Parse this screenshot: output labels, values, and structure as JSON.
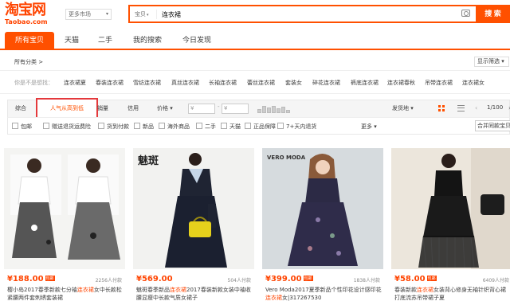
{
  "header": {
    "logo_main": "淘宝网",
    "logo_sub": "Taobao.com",
    "market_label": "更多市场",
    "scope_label": "宝贝",
    "query": "连衣裙",
    "search_label": "搜 索"
  },
  "nav": {
    "tabs": [
      {
        "label": "所有宝贝",
        "active": true
      },
      {
        "label": "天猫"
      },
      {
        "label": "二手"
      },
      {
        "label": "我的搜索"
      },
      {
        "label": "今日发现"
      }
    ]
  },
  "filters": {
    "all_categories": "所有分类 >",
    "display_filter": "显示筛选",
    "suggest_label": "你是不是想找：",
    "suggestions": [
      "连衣裙夏",
      "春装连衣裙",
      "雪纺连衣裙",
      "真丝连衣裙",
      "长袖连衣裙",
      "蕾丝连衣裙",
      "套装女",
      "碎花连衣裙",
      "裤底连衣裙",
      "连衣裙春秋",
      "吊带连衣裙",
      "连衣裙女"
    ]
  },
  "sort": {
    "comprehensive": "综合",
    "popular": "人气从高到低",
    "sales": "销量",
    "credit": "信用",
    "price": "价格",
    "price_from": "¥",
    "price_to": "¥",
    "ship_from": "发货地",
    "page_label": "1/100"
  },
  "checks": {
    "items": [
      "包邮",
      "赠送退货运费险",
      "货到付款",
      "新品",
      "海外商品",
      "二手",
      "天猫",
      "正品保障",
      "7+天内退货"
    ],
    "more_label": "更多",
    "merge_label": "合并同款宝贝"
  },
  "products": [
    {
      "price": "¥188.00",
      "badge": "包邮",
      "sold": "2256人付款",
      "title_pre": "樱小岛2017春季新款七分袖",
      "title_hl": "连衣裙",
      "title_post": "女中长款松紧腰两件套刺绣套装裙"
    },
    {
      "price": "¥569.00",
      "badge": "",
      "sold": "504人付款",
      "title_pre": "魅斑春季新品",
      "title_hl": "连衣裙",
      "title_post": "2017春装新款女装中袖收腰显瘦中长款气质女裙子"
    },
    {
      "price": "¥399.00",
      "badge": "包邮",
      "sold": "1838人付款",
      "title_pre": "Vero Moda2017夏季新品个性印花设计感印花",
      "title_hl": "连衣裙",
      "title_post": "女|317267530"
    },
    {
      "price": "¥58.00",
      "badge": "包邮",
      "sold": "6409人付款",
      "title_pre": "春装新款",
      "title_hl": "连衣裙",
      "title_post": "女装背心修身无袖针织背心裙打底流苏吊带裙子夏"
    }
  ],
  "colors": {
    "accent": "#ff5000",
    "price": "#ff4400",
    "highlight_box": "#e4393c"
  }
}
